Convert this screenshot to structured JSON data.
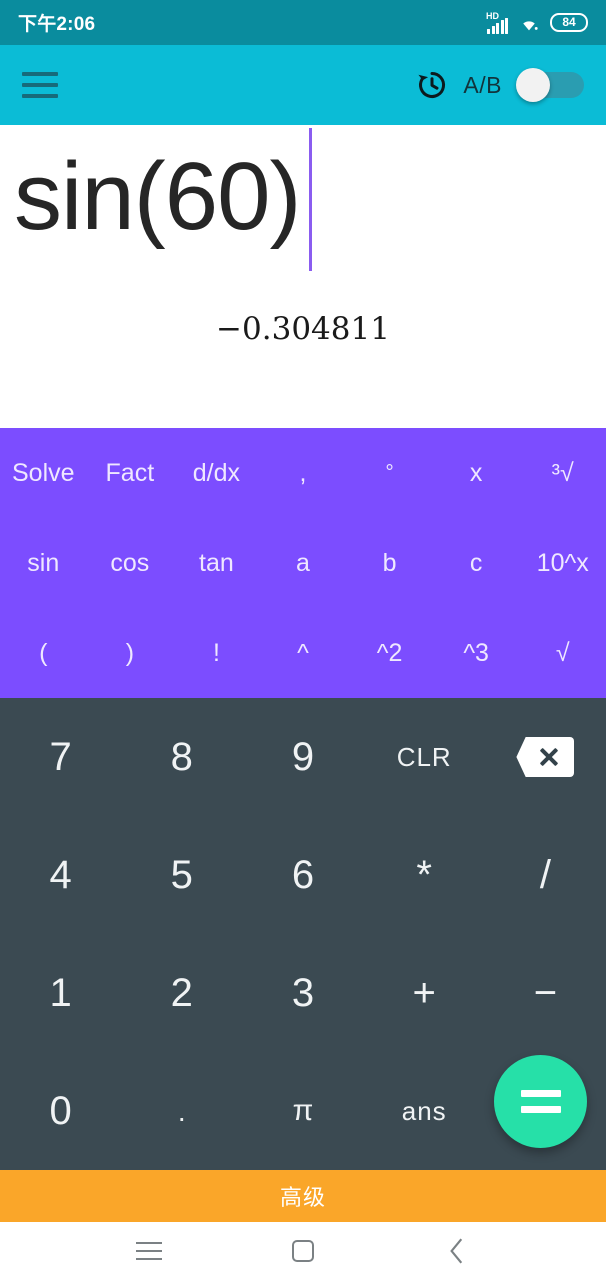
{
  "status_bar": {
    "time": "下午2:06",
    "network_label": "HD",
    "signal_icon": "signal-bars-icon",
    "wifi_icon": "wifi-icon",
    "battery_level": "84"
  },
  "app_bar": {
    "menu_icon": "hamburger-menu-icon",
    "history_icon": "history-clock-icon",
    "ab_label": "A/B",
    "toggle_state": "off"
  },
  "display": {
    "expression": "sin(60)",
    "expression_prefix": "sin(60",
    "expression_suffix": ")",
    "result": "−0.304811",
    "cursor_visible": true,
    "cursor_color": "#8a5cf0"
  },
  "function_pad": {
    "background": "#7c4dff",
    "keys": [
      {
        "label": "Solve",
        "name": "solve",
        "size": "normal"
      },
      {
        "label": "Fact",
        "name": "fact",
        "size": "normal"
      },
      {
        "label": "d/dx",
        "name": "derivative",
        "size": "normal"
      },
      {
        "label": ",",
        "name": "comma",
        "size": "normal"
      },
      {
        "label": "°",
        "name": "degree",
        "size": "small"
      },
      {
        "label": "x",
        "name": "variable-x",
        "size": "normal"
      },
      {
        "label": "³√",
        "name": "cube-root",
        "size": "normal"
      },
      {
        "label": "sin",
        "name": "sin",
        "size": "normal"
      },
      {
        "label": "cos",
        "name": "cos",
        "size": "normal"
      },
      {
        "label": "tan",
        "name": "tan",
        "size": "normal"
      },
      {
        "label": "a",
        "name": "variable-a",
        "size": "normal"
      },
      {
        "label": "b",
        "name": "variable-b",
        "size": "normal"
      },
      {
        "label": "c",
        "name": "variable-c",
        "size": "normal"
      },
      {
        "label": "10^x",
        "name": "ten-power-x",
        "size": "normal"
      },
      {
        "label": "(",
        "name": "open-paren",
        "size": "normal"
      },
      {
        "label": ")",
        "name": "close-paren",
        "size": "normal"
      },
      {
        "label": "!",
        "name": "factorial",
        "size": "normal"
      },
      {
        "label": "^",
        "name": "power",
        "size": "normal"
      },
      {
        "label": "^2",
        "name": "square",
        "size": "normal"
      },
      {
        "label": "^3",
        "name": "cube",
        "size": "normal"
      },
      {
        "label": "√",
        "name": "square-root",
        "size": "normal"
      }
    ]
  },
  "number_pad": {
    "background": "#3b4a52",
    "keys": [
      {
        "label": "7",
        "name": "digit-7",
        "kind": "digit"
      },
      {
        "label": "8",
        "name": "digit-8",
        "kind": "digit"
      },
      {
        "label": "9",
        "name": "digit-9",
        "kind": "digit"
      },
      {
        "label": "CLR",
        "name": "clear",
        "kind": "label"
      },
      {
        "label": "",
        "name": "backspace",
        "kind": "backspace"
      },
      {
        "label": "4",
        "name": "digit-4",
        "kind": "digit"
      },
      {
        "label": "5",
        "name": "digit-5",
        "kind": "digit"
      },
      {
        "label": "6",
        "name": "digit-6",
        "kind": "digit"
      },
      {
        "label": "*",
        "name": "multiply",
        "kind": "digit"
      },
      {
        "label": "/",
        "name": "divide",
        "kind": "digit"
      },
      {
        "label": "1",
        "name": "digit-1",
        "kind": "digit"
      },
      {
        "label": "2",
        "name": "digit-2",
        "kind": "digit"
      },
      {
        "label": "3",
        "name": "digit-3",
        "kind": "digit"
      },
      {
        "label": "+",
        "name": "plus",
        "kind": "digit"
      },
      {
        "label": "−",
        "name": "minus",
        "kind": "digit"
      },
      {
        "label": "0",
        "name": "digit-0",
        "kind": "digit"
      },
      {
        "label": ".",
        "name": "decimal-point",
        "kind": "dot"
      },
      {
        "label": "π",
        "name": "pi",
        "kind": "pi"
      },
      {
        "label": "ans",
        "name": "ans",
        "kind": "label"
      },
      {
        "label": "",
        "name": "fab-spacer",
        "kind": "empty"
      }
    ],
    "equals_button": {
      "label": "=",
      "name": "equals",
      "color": "#26e0a8"
    }
  },
  "advanced_bar": {
    "label": "高级",
    "color": "#faa629"
  },
  "nav_bar": {
    "menu_icon": "nav-menu-icon",
    "home_icon": "nav-home-icon",
    "back_icon": "nav-back-icon"
  }
}
